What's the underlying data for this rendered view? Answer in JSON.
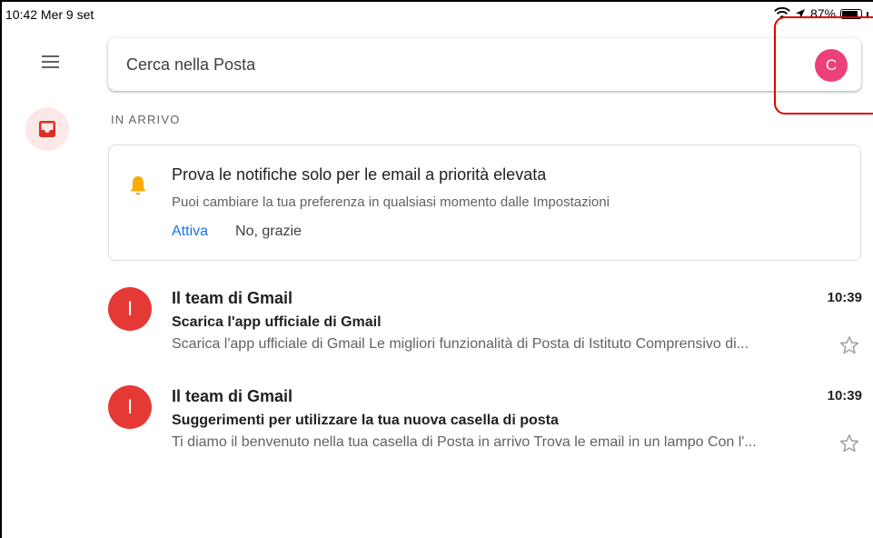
{
  "status_bar": {
    "time": "10:42  Mer 9 set",
    "battery": "87%",
    "battery_level": 0.87
  },
  "search": {
    "placeholder": "Cerca nella Posta",
    "avatar_letter": "C",
    "avatar_color": "#ec407a"
  },
  "icons": {
    "menu": "hamburger-menu-icon",
    "inbox": "inbox-icon",
    "bell": "bell-icon",
    "star": "star-outline-icon",
    "wifi": "wifi-icon",
    "location": "location-arrow-icon"
  },
  "inbox": {
    "label": "IN ARRIVO"
  },
  "notification": {
    "title": "Prova le notifiche solo per le email a priorità elevata",
    "body": "Puoi cambiare la tua preferenza in qualsiasi momento dalle Impostazioni",
    "activate_label": "Attiva",
    "decline_label": "No, grazie"
  },
  "emails": [
    {
      "avatar_letter": "I",
      "sender": "Il team di Gmail",
      "time": "10:39",
      "subject": "Scarica l'app ufficiale di Gmail",
      "snippet": "Scarica l'app ufficiale di Gmail Le migliori funzionalità di Posta di Istituto Comprensivo di..."
    },
    {
      "avatar_letter": "I",
      "sender": "Il team di Gmail",
      "time": "10:39",
      "subject": "Suggerimenti per utilizzare la tua nuova casella di posta",
      "snippet": "Ti diamo il benvenuto nella tua casella di Posta in arrivo Trova le email in un lampo Con l'..."
    }
  ],
  "colors": {
    "accent": "#1a73e8",
    "brand_red": "#e53935",
    "highlight": "#e00000",
    "bell": "#f9ab00"
  }
}
